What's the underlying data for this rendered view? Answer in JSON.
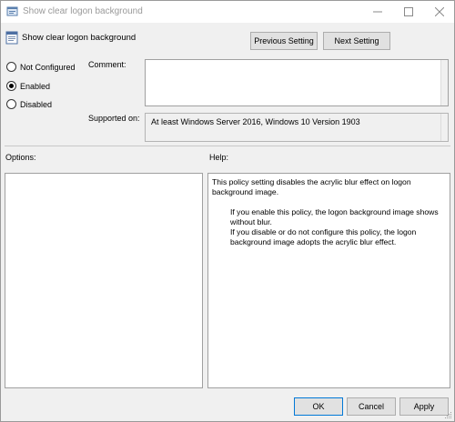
{
  "window": {
    "title": "Show clear logon background"
  },
  "header": {
    "setting_title": "Show clear logon background",
    "previous_label": "Previous Setting",
    "next_label": "Next Setting"
  },
  "state": {
    "options": [
      {
        "label": "Not Configured",
        "checked": false
      },
      {
        "label": "Enabled",
        "checked": true
      },
      {
        "label": "Disabled",
        "checked": false
      }
    ]
  },
  "comment": {
    "label": "Comment:",
    "value": ""
  },
  "supported": {
    "label": "Supported on:",
    "value": "At least Windows Server 2016, Windows 10 Version 1903"
  },
  "options_panel": {
    "label": "Options:"
  },
  "help": {
    "label": "Help:",
    "paragraphs": [
      "This policy setting disables the acrylic blur effect on logon background image.",
      "If you enable this policy, the logon background image shows without blur.",
      "If you disable or do not configure this policy, the logon background image adopts the acrylic blur effect."
    ]
  },
  "footer": {
    "ok_label": "OK",
    "cancel_label": "Cancel",
    "apply_label": "Apply"
  },
  "icons": {
    "title": "policy-setting-icon",
    "minimize": "minimize-icon",
    "maximize": "maximize-icon",
    "close": "close-icon"
  }
}
